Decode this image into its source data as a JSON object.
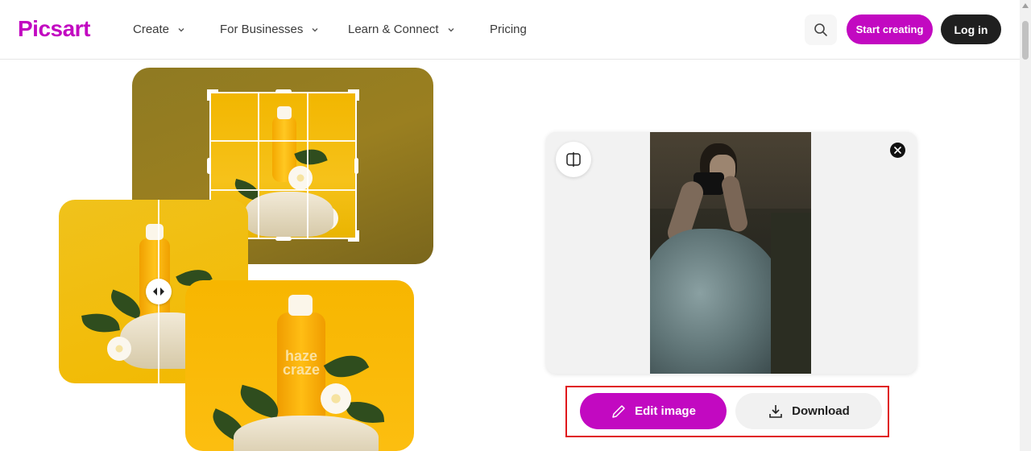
{
  "nav": {
    "logo": "Picsart",
    "items": [
      {
        "label": "Create",
        "has_dropdown": true
      },
      {
        "label": "For Businesses",
        "has_dropdown": true
      },
      {
        "label": "Learn & Connect",
        "has_dropdown": true
      },
      {
        "label": "Pricing",
        "has_dropdown": false
      }
    ],
    "search_icon": "search-icon",
    "start_label": "Start creating",
    "login_label": "Log in"
  },
  "collage": {
    "product_label_line1": "haze",
    "product_label_line2": "craze"
  },
  "preview": {
    "compare_icon": "compare-icon",
    "close_icon": "close-icon"
  },
  "actions": {
    "edit_label": "Edit image",
    "edit_icon": "pencil-icon",
    "download_label": "Download",
    "download_icon": "download-icon"
  },
  "colors": {
    "brand": "#c209c1",
    "dark": "#1f1f1f",
    "highlight": "#e0171b"
  }
}
